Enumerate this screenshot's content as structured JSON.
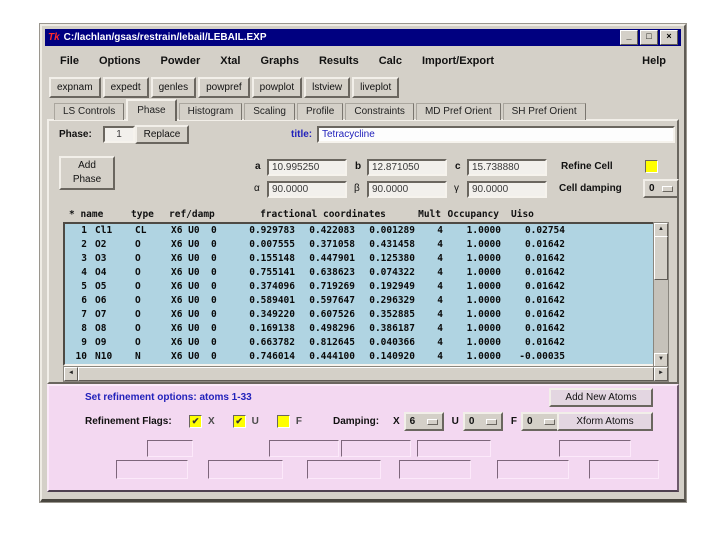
{
  "window": {
    "title": "C:/lachlan/gsas/restrain/lebail/LEBAIL.EXP",
    "tk_icon": "Tk",
    "minimize_glyph": "_",
    "maximize_glyph": "□",
    "close_glyph": "×"
  },
  "menu": {
    "items": [
      "File",
      "Options",
      "Powder",
      "Xtal",
      "Graphs",
      "Results",
      "Calc",
      "Import/Export"
    ],
    "help": "Help"
  },
  "toolbar": {
    "buttons": [
      "expnam",
      "expedt",
      "genles",
      "powpref",
      "powplot",
      "lstview",
      "liveplot"
    ]
  },
  "tabs": {
    "items": [
      "LS Controls",
      "Phase",
      "Histogram",
      "Scaling",
      "Profile",
      "Constraints",
      "MD Pref Orient",
      "SH Pref Orient"
    ],
    "active": "Phase"
  },
  "phase": {
    "phase_label": "Phase:",
    "phase_number": "1",
    "replace_button": "Replace",
    "title_label": "title:",
    "title_value": "Tetracycline",
    "add_phase_button": [
      "Add",
      "Phase"
    ],
    "a_label": "a",
    "a_value": "10.995250",
    "b_label": "b",
    "b_value": "12.871050",
    "c_label": "c",
    "c_value": "15.738880",
    "alpha_label": "α",
    "alpha_value": "90.0000",
    "beta_label": "β",
    "beta_value": "90.0000",
    "gamma_label": "γ",
    "gamma_value": "90.0000",
    "refine_cell_label": "Refine Cell",
    "cell_damping_label": "Cell damping",
    "cell_damping_value": "0"
  },
  "atom_table": {
    "headers": {
      "name": "* name",
      "type": "type",
      "ref": "ref/damp",
      "frac": "fractional coordinates",
      "mult": "Mult",
      "occ": "Occupancy",
      "uiso": "Uiso"
    },
    "rows": [
      {
        "num": "1",
        "name": "Cl1",
        "type": "CL",
        "ref": "X6 U0  0",
        "x": "0.929783",
        "y": "0.422083",
        "z": "0.001289",
        "mult": "4",
        "occ": "1.0000",
        "uiso": "0.02754"
      },
      {
        "num": "2",
        "name": "O2",
        "type": "O",
        "ref": "X6 U0  0",
        "x": "0.007555",
        "y": "0.371058",
        "z": "0.431458",
        "mult": "4",
        "occ": "1.0000",
        "uiso": "0.01642"
      },
      {
        "num": "3",
        "name": "O3",
        "type": "O",
        "ref": "X6 U0  0",
        "x": "0.155148",
        "y": "0.447901",
        "z": "0.125380",
        "mult": "4",
        "occ": "1.0000",
        "uiso": "0.01642"
      },
      {
        "num": "4",
        "name": "O4",
        "type": "O",
        "ref": "X6 U0  0",
        "x": "0.755141",
        "y": "0.638623",
        "z": "0.074322",
        "mult": "4",
        "occ": "1.0000",
        "uiso": "0.01642"
      },
      {
        "num": "5",
        "name": "O5",
        "type": "O",
        "ref": "X6 U0  0",
        "x": "0.374096",
        "y": "0.719269",
        "z": "0.192949",
        "mult": "4",
        "occ": "1.0000",
        "uiso": "0.01642"
      },
      {
        "num": "6",
        "name": "O6",
        "type": "O",
        "ref": "X6 U0  0",
        "x": "0.589401",
        "y": "0.597647",
        "z": "0.296329",
        "mult": "4",
        "occ": "1.0000",
        "uiso": "0.01642"
      },
      {
        "num": "7",
        "name": "O7",
        "type": "O",
        "ref": "X6 U0  0",
        "x": "0.349220",
        "y": "0.607526",
        "z": "0.352885",
        "mult": "4",
        "occ": "1.0000",
        "uiso": "0.01642"
      },
      {
        "num": "8",
        "name": "O8",
        "type": "O",
        "ref": "X6 U0  0",
        "x": "0.169138",
        "y": "0.498296",
        "z": "0.386187",
        "mult": "4",
        "occ": "1.0000",
        "uiso": "0.01642"
      },
      {
        "num": "9",
        "name": "O9",
        "type": "O",
        "ref": "X6 U0  0",
        "x": "0.663782",
        "y": "0.812645",
        "z": "0.040366",
        "mult": "4",
        "occ": "1.0000",
        "uiso": "0.01642"
      },
      {
        "num": "10",
        "name": "N10",
        "type": "N",
        "ref": "X6 U0  0",
        "x": "0.746014",
        "y": "0.444100",
        "z": "0.140920",
        "mult": "4",
        "occ": "1.0000",
        "uiso": "-0.00035"
      }
    ]
  },
  "refinement": {
    "heading": "Set refinement options: atoms 1-33",
    "add_new_atoms_button": "Add New Atoms",
    "xform_atoms_button": "Xform Atoms",
    "flags_label": "Refinement Flags:",
    "flags": [
      {
        "label": "X",
        "checked": true
      },
      {
        "label": "U",
        "checked": true
      },
      {
        "label": "F",
        "checked": false
      }
    ],
    "damping_label": "Damping:",
    "damping": [
      {
        "label": "X",
        "value": "6"
      },
      {
        "label": "U",
        "value": "0"
      },
      {
        "label": "F",
        "value": "0"
      }
    ],
    "check_glyph": "✔"
  },
  "icons": {
    "scroll_up": "▲",
    "scroll_down": "▼",
    "scroll_left": "◄",
    "scroll_right": "►"
  },
  "colors": {
    "titlebar": "#000080",
    "window_bg": "#d4d0c8",
    "table_bg": "#b0d4e2",
    "panel_pink": "#f3d8f1",
    "accent_blue": "#2222bb",
    "checkbox_yellow": "#ffff00"
  }
}
